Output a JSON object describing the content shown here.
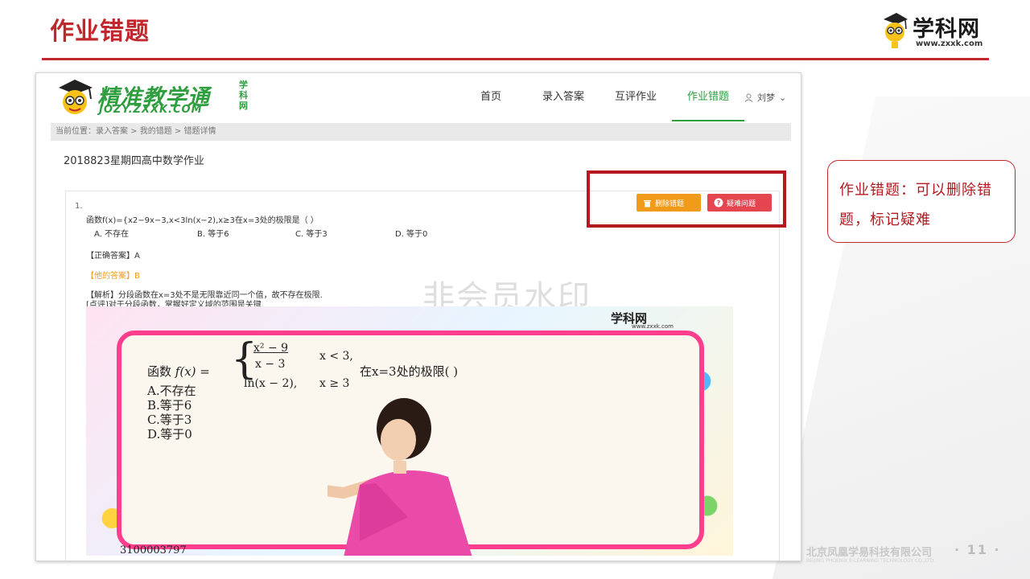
{
  "slide": {
    "title": "作业错题",
    "note": "作业错题：可以删除错题，标记疑难",
    "page_number": "· 11 ·",
    "company": "北京凤凰学易科技有限公司",
    "company_en": "BEIJING PHOENIX E-LEARNING TECHNOLOGY CO.,LTD."
  },
  "brand": {
    "name": "学科网",
    "url": "www.zxxk.com"
  },
  "app": {
    "logo_title": "精准教学通",
    "logo_sub": "JOZY.ZXXK.COM",
    "logo_side": "学科网",
    "nav": [
      "首页",
      "录入答案",
      "互评作业",
      "作业错题"
    ],
    "active_nav": "作业错题",
    "user": "刘梦",
    "breadcrumb": "当前位置：录入答案 > 我的错题 > 错题详情",
    "homework_title": "2018823星期四高中数学作业",
    "btn_delete": "删除错题",
    "btn_mark": "疑难问题",
    "question_number": "1.",
    "question_text": "函数f(x)={x2−9x−3,x<3ln(x−2),x≥3在x=3处的极限是（ ）",
    "options": [
      "A. 不存在",
      "B. 等于6",
      "C. 等于3",
      "D. 等于0"
    ],
    "correct_answer": "【正确答案】A",
    "his_answer": "【他的答案】B",
    "analysis": "【解析】分段函数在x=3处不是无限靠近同一个值，故不存在极限.",
    "comment": "[点评]对于分段函数，掌握好定义域的范围是关键.",
    "watermark": "非会员水印"
  },
  "video": {
    "brand": "学科网",
    "url": "www.zxxk.com",
    "formula_prefix": "函数",
    "f_label": "f(x) =",
    "case1": "x² − 9",
    "case1_den": "x − 3",
    "case1_cond": "x < 3,",
    "case2": "ln(x − 2),",
    "case2_cond": "x ≥ 3",
    "formula_suffix": "在x=3处的极限(    )",
    "options": [
      "A.不存在",
      "B.等于6",
      "C.等于3",
      "D.等于0"
    ],
    "caption": "3100003797"
  },
  "colors": {
    "accent": "#c0282e",
    "green": "#2e9e3f",
    "orange": "#f29a1a",
    "pink": "#ff3f8e"
  }
}
